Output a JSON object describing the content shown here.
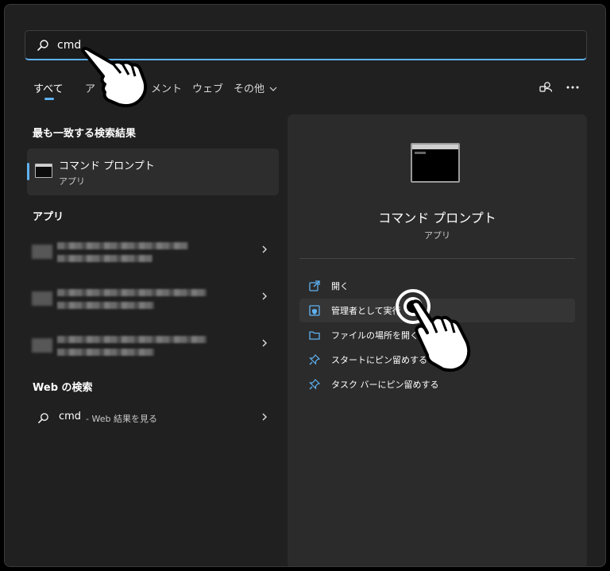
{
  "search": {
    "query": "cmd"
  },
  "tabs": {
    "all": "すべて",
    "apps_partial": "ア",
    "documents_partial": "メント",
    "web": "ウェブ",
    "more": "その他 ⌵",
    "more_label": "その他"
  },
  "best_match": {
    "heading": "最も一致する検索結果",
    "name": "コマンド プロンプト",
    "type": "アプリ"
  },
  "apps": {
    "heading": "アプリ"
  },
  "web_search": {
    "heading": "Web の検索",
    "query": "cmd",
    "suffix": "- Web 結果を見る"
  },
  "detail": {
    "name": "コマンド プロンプト",
    "type": "アプリ",
    "actions": [
      {
        "label": "開く",
        "icon": "open-icon"
      },
      {
        "label": "管理者として実行",
        "icon": "shield-icon"
      },
      {
        "label": "ファイルの場所を開く",
        "icon": "folder-icon"
      },
      {
        "label": "スタートにピン留めする",
        "icon": "pin-icon"
      },
      {
        "label": "タスク バーにピン留めする",
        "icon": "pin-icon"
      }
    ]
  },
  "colors": {
    "accent": "#5fb2f2",
    "background": "#202020",
    "panel": "#2b2b2b"
  }
}
